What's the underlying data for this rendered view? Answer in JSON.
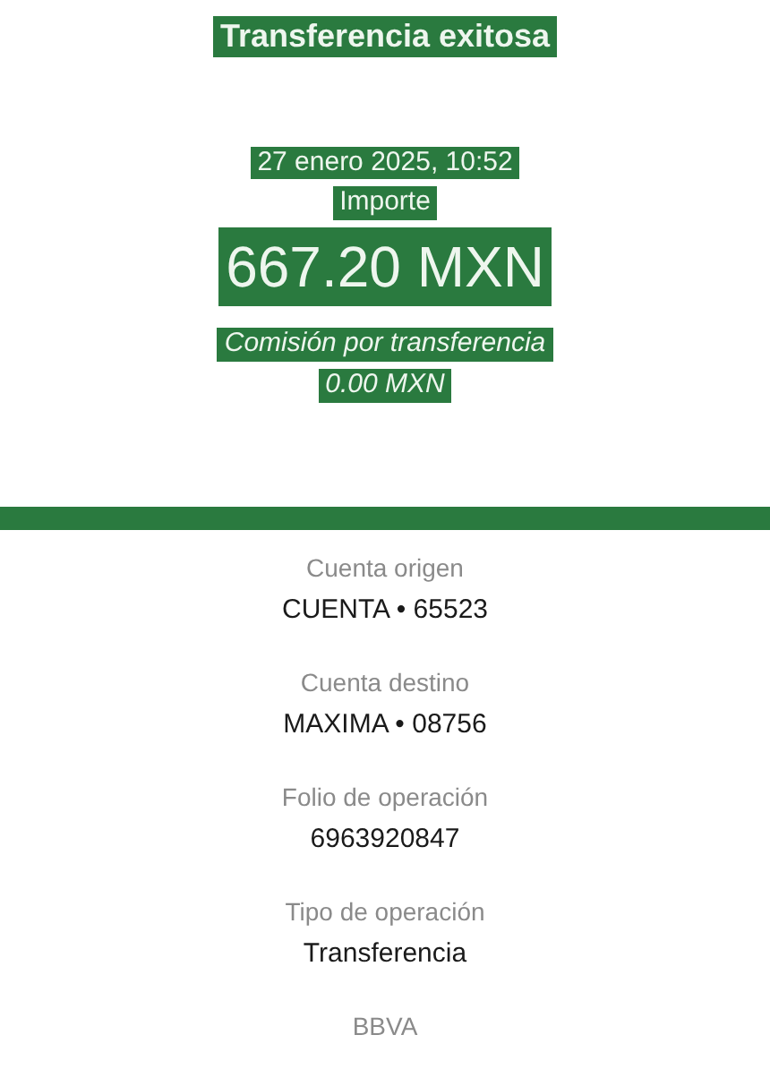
{
  "header": {
    "title": "Transferencia exitosa",
    "date": "27 enero 2025, 10:52",
    "amount_label": "Importe",
    "amount": "667.20 MXN",
    "fee_label": "Comisión por transferencia",
    "fee": "0.00 MXN"
  },
  "details": [
    {
      "label": "Cuenta origen",
      "value": "CUENTA • 65523"
    },
    {
      "label": "Cuenta destino",
      "value": "MAXIMA • 08756"
    },
    {
      "label": "Folio de operación",
      "value": "6963920847"
    },
    {
      "label": "Tipo de operación",
      "value": "Transferencia"
    }
  ],
  "footer": "BBVA"
}
